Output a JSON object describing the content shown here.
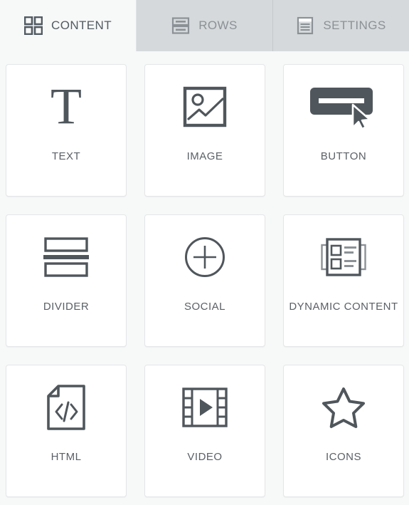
{
  "tabs": [
    {
      "label": "CONTENT",
      "icon": "grid-icon",
      "active": true
    },
    {
      "label": "ROWS",
      "icon": "rows-icon",
      "active": false
    },
    {
      "label": "SETTINGS",
      "icon": "settings-icon",
      "active": false
    }
  ],
  "content_items": [
    {
      "label": "TEXT",
      "icon": "text-icon"
    },
    {
      "label": "IMAGE",
      "icon": "image-icon"
    },
    {
      "label": "BUTTON",
      "icon": "button-cursor-icon"
    },
    {
      "label": "DIVIDER",
      "icon": "divider-icon"
    },
    {
      "label": "SOCIAL",
      "icon": "circle-plus-icon"
    },
    {
      "label": "DYNAMIC CONTENT",
      "icon": "dynamic-content-icon"
    },
    {
      "label": "HTML",
      "icon": "code-document-icon"
    },
    {
      "label": "VIDEO",
      "icon": "film-play-icon"
    },
    {
      "label": "ICONS",
      "icon": "star-icon"
    }
  ],
  "colors": {
    "icon_dark": "#4f565c",
    "label_text": "#5a6066",
    "tab_active_bg": "#f7f8f8",
    "tab_inactive_bg": "#d6d9db",
    "tab_inactive_text": "#8b9196",
    "card_bg": "#ffffff",
    "card_border": "#e4e6e8",
    "page_bg": "#f7f8f8"
  }
}
